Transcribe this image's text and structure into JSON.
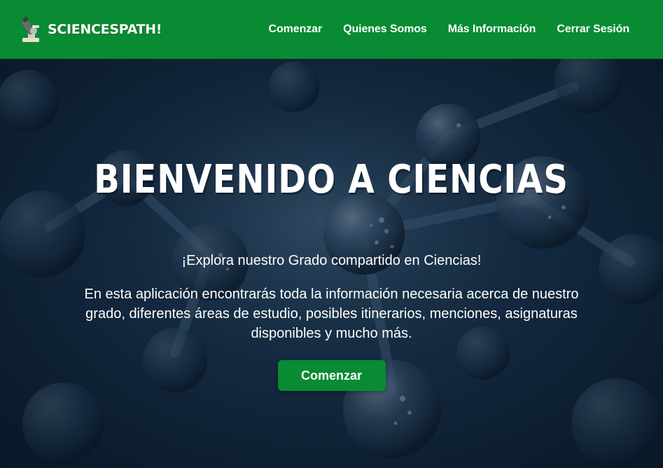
{
  "brand": {
    "name": "SCIENCESPATH!",
    "icon": "microscope-icon"
  },
  "nav": {
    "items": [
      {
        "label": "Comenzar"
      },
      {
        "label": "Quienes Somos"
      },
      {
        "label": "Más Información"
      },
      {
        "label": "Cerrar Sesión"
      }
    ]
  },
  "hero": {
    "title": "BIENVENIDO A CIENCIAS",
    "subtitle": "¡Explora nuestro Grado compartido en Ciencias!",
    "description": "En esta aplicación encontrarás toda la información necesaria acerca de nuestro grado, diferentes áreas de estudio, posibles itinerarios, menciones, asignaturas disponibles y mucho más.",
    "button_label": "Comenzar",
    "background": "molecules-image"
  },
  "colors": {
    "primary": "#088b32",
    "text": "#ffffff",
    "hero_bg": "#12243a"
  }
}
